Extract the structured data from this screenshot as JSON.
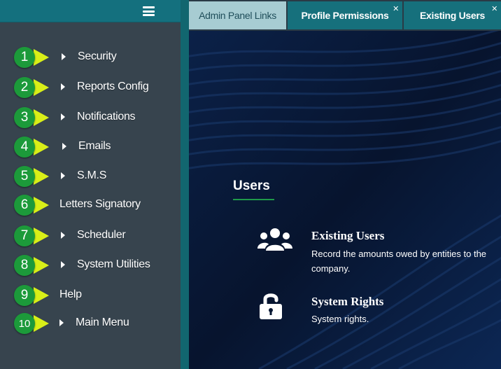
{
  "sidebar": {
    "items": [
      {
        "num": "1",
        "label": "Security",
        "has_caret": true
      },
      {
        "num": "2",
        "label": "Reports Config",
        "has_caret": true
      },
      {
        "num": "3",
        "label": "Notifications",
        "has_caret": true
      },
      {
        "num": "4",
        "label": "Emails",
        "has_caret": true
      },
      {
        "num": "5",
        "label": "S.M.S",
        "has_caret": true
      },
      {
        "num": "6",
        "label": "Letters Signatory",
        "has_caret": false
      },
      {
        "num": "7",
        "label": "Scheduler",
        "has_caret": true
      },
      {
        "num": "8",
        "label": "System Utilities",
        "has_caret": true
      },
      {
        "num": "9",
        "label": "Help",
        "has_caret": false
      },
      {
        "num": "10",
        "label": "Main Menu",
        "has_caret": true
      }
    ]
  },
  "tabs": [
    {
      "label": "Admin Panel Links",
      "active": true,
      "closable": false
    },
    {
      "label": "Profile Permissions",
      "active": false,
      "closable": true
    },
    {
      "label": "Existing Users",
      "active": false,
      "closable": true
    }
  ],
  "content": {
    "section_title": "Users",
    "cards": [
      {
        "title": "Existing Users",
        "description": "Record the amounts owed by entities to the company.",
        "icon": "users-icon"
      },
      {
        "title": "System Rights",
        "description": "System rights.",
        "icon": "unlock-icon"
      }
    ]
  },
  "colors": {
    "sidebar_bg": "#37444e",
    "accent_teal": "#14707e",
    "badge_green": "#1c9a3a",
    "pointer_yellow": "#d9ef18",
    "active_tab": "#a7ccd2",
    "content_bg": "#071632"
  }
}
